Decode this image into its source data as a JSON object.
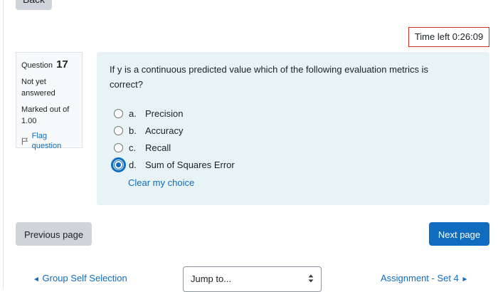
{
  "nav_top": {
    "back_label": "Back"
  },
  "timer": {
    "label": "Time left",
    "value": "0:26:09"
  },
  "question_info": {
    "question_label": "Question",
    "number": "17",
    "state": "Not yet answered",
    "grade": "Marked out of 1.00",
    "flag_label": "Flag question"
  },
  "question": {
    "text": "If y is a continuous predicted value which of the following evaluation metrics is correct?",
    "answers": [
      {
        "letter": "a.",
        "text": "Precision",
        "selected": false
      },
      {
        "letter": "b.",
        "text": "Accuracy",
        "selected": false
      },
      {
        "letter": "c.",
        "text": "Recall",
        "selected": false
      },
      {
        "letter": "d.",
        "text": "Sum of Squares Error",
        "selected": true
      }
    ],
    "clear_label": "Clear my choice"
  },
  "buttons": {
    "previous_label": "Previous page",
    "next_label": "Next page"
  },
  "bottom_nav": {
    "prev_link": "Group Self Selection",
    "jump_select": "Jump to...",
    "next_link": "Assignment - Set 4"
  },
  "colors": {
    "accent": "#0f6cbf",
    "formulation_bg": "#e7f3f5",
    "timer_border": "#ca3120",
    "secondary_button": "#ced4da"
  },
  "icons": {
    "flag": "flag-icon",
    "prev_arrow": "left-arrow-icon",
    "next_arrow": "right-arrow-icon",
    "select_caret": "up-down-caret-icon"
  }
}
